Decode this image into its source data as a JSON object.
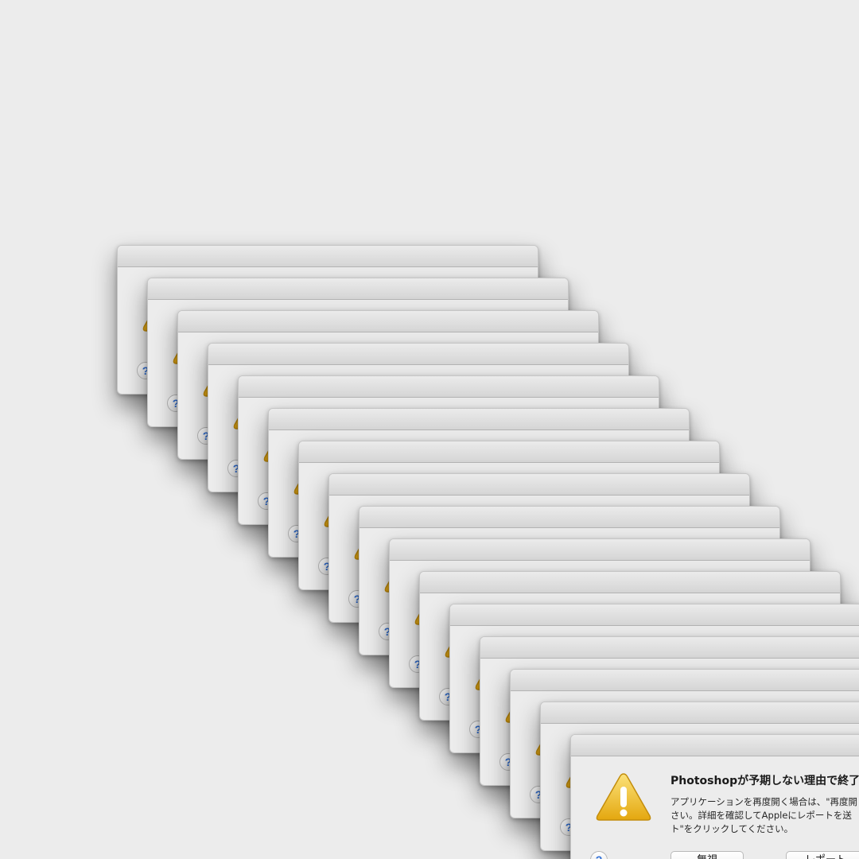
{
  "dialog": {
    "title": "Photoshopが予期しない理由で終了",
    "body_lines": [
      "アプリケーションを再度開く場合は、\"再度開",
      "さい。詳細を確認してAppleにレポートを送",
      "ト\"をクリックしてください。"
    ],
    "ignore_label": "無視",
    "report_label": "レポート",
    "help_label": "?",
    "icon": "warning-triangle-icon"
  },
  "colors": {
    "desktop": "#ececec",
    "warning_yellow": "#f2c21b",
    "help_blue": "#2f6fd6"
  }
}
